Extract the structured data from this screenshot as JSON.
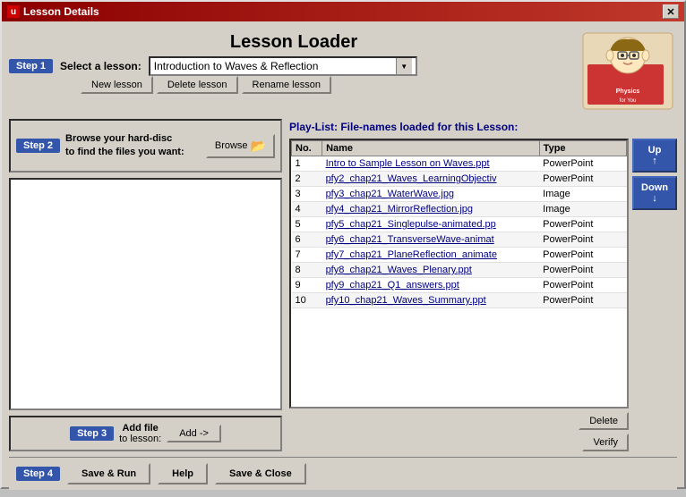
{
  "window": {
    "title": "Lesson Details",
    "close_label": "✕"
  },
  "header": {
    "title": "Lesson Loader"
  },
  "step1": {
    "badge": "Step 1",
    "label": "Select a lesson:",
    "selected_lesson": "Introduction to Waves & Reflection"
  },
  "lesson_buttons": {
    "new": "New lesson",
    "delete": "Delete lesson",
    "rename": "Rename lesson"
  },
  "step2": {
    "badge": "Step 2",
    "text": "Browse your hard-disc\nto find the files you want:",
    "browse_label": "Browse"
  },
  "step3": {
    "badge": "Step 3",
    "title": "Add file",
    "subtitle": "to lesson:",
    "add_label": "Add ->"
  },
  "playlist": {
    "header": "Play-List: File-names loaded for this Lesson:",
    "columns": {
      "no": "No.",
      "name": "Name",
      "type": "Type"
    },
    "items": [
      {
        "no": "1",
        "name": "Intro to Sample Lesson on Waves.ppt",
        "type": "PowerPoint"
      },
      {
        "no": "2",
        "name": "pfy2_chap21_Waves_LearningObjectiv",
        "type": "PowerPoint"
      },
      {
        "no": "3",
        "name": "pfy3_chap21_WaterWave.jpg",
        "type": "Image"
      },
      {
        "no": "4",
        "name": "pfy4_chap21_MirrorReflection.jpg",
        "type": "Image"
      },
      {
        "no": "5",
        "name": "pfy5_chap21_Singlepulse-animated.pp",
        "type": "PowerPoint"
      },
      {
        "no": "6",
        "name": "pfy6_chap21_TransverseWave-animat",
        "type": "PowerPoint"
      },
      {
        "no": "7",
        "name": "pfy7_chap21_PlaneReflection_animate",
        "type": "PowerPoint"
      },
      {
        "no": "8",
        "name": "pfy8_chap21_Waves_Plenary.ppt",
        "type": "PowerPoint"
      },
      {
        "no": "9",
        "name": "pfy9_chap21_Q1_answers.ppt",
        "type": "PowerPoint"
      },
      {
        "no": "10",
        "name": "pfy10_chap21_Waves_Summary.ppt",
        "type": "PowerPoint"
      }
    ]
  },
  "controls": {
    "up": "Up",
    "up_arrow": "↑",
    "down": "Down",
    "down_arrow": "↓",
    "delete": "Delete",
    "verify": "Verify"
  },
  "step4": {
    "badge": "Step 4",
    "save_run": "Save & Run",
    "help": "Help",
    "save_close": "Save & Close"
  }
}
